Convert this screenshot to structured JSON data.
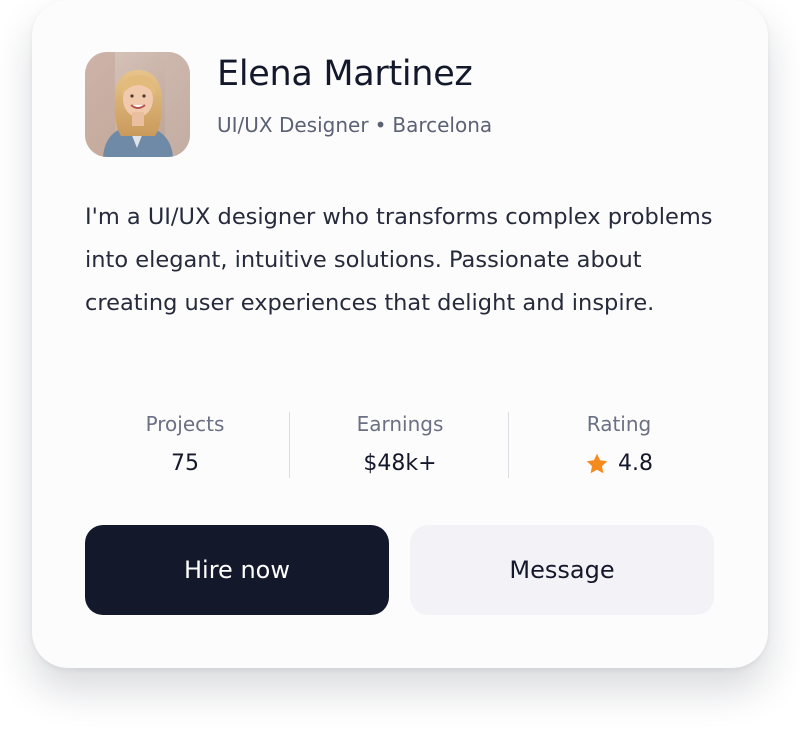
{
  "profile": {
    "name": "Elena Martinez",
    "role": "UI/UX Designer",
    "separator": "•",
    "location": "Barcelona",
    "avatar_icon": "user-photo",
    "bio": "I'm a UI/UX designer who transforms complex problems into elegant, intuitive solutions. Passionate about creating user experiences that delight and inspire."
  },
  "stats": [
    {
      "label": "Projects",
      "value": "75"
    },
    {
      "label": "Earnings",
      "value": "$48k+"
    },
    {
      "label": "Rating",
      "value": "4.8",
      "icon": "star-icon",
      "icon_color": "#f58a1f"
    }
  ],
  "actions": {
    "hire_label": "Hire now",
    "message_label": "Message"
  },
  "colors": {
    "primary_button": "#14182b",
    "secondary_button": "#f3f3f7",
    "card_background": "#fcfcfd"
  }
}
